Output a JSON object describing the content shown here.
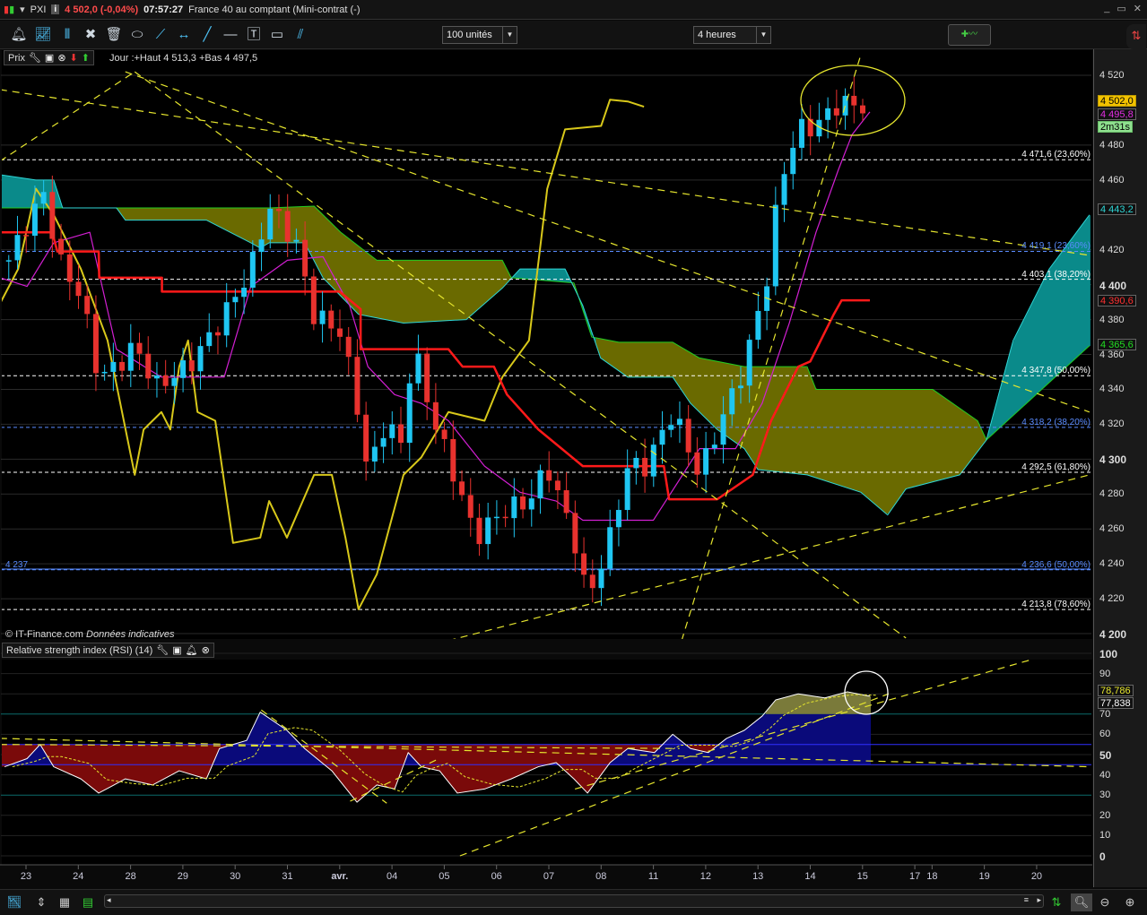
{
  "titlebar": {
    "symbol": "PXI",
    "price_change": "4 502,0 (-0,04%)",
    "time": "07:57:27",
    "instrument": "France 40 au comptant (Mini-contrat  (-)",
    "info_label": "i",
    "window_buttons": [
      "_",
      "▭",
      "✕"
    ]
  },
  "toolbar": {
    "units_dropdown": "100 unités",
    "period_dropdown": "4 heures"
  },
  "price_panel": {
    "header_label": "Prix",
    "day_info": "Jour :+Haut 4 513,3 +Bas 4 497,5",
    "copyright": "© IT-Finance.com",
    "disclaimer": "Données indicatives",
    "left_level_label": "4 237"
  },
  "rsi_panel": {
    "header_label": "Relative strength index (RSI) (14)"
  },
  "price_tags": {
    "last": "4 502,0",
    "tenkan": "4 495,8",
    "countdown": "2m31s",
    "cloud_b": "4 443,2",
    "kijun": "4 390,6",
    "cloud_a": "4 365,6",
    "rsi": "78,786",
    "rsi_signal": "77,838"
  },
  "colors": {
    "up": "#1fc6f2",
    "down": "#e8322e",
    "kijun": "#ff1a1a",
    "tenkan": "#d21fd2",
    "chikou": "#d8c81a",
    "span_a": "#22cc22",
    "span_b": "#2fd6d6",
    "cloud_bull": "#6a6a00",
    "cloud_bear": "#0a8a8a",
    "trend": "#e6e62e",
    "fib_white": "#ffffff",
    "fib_blue": "#5a8cff"
  },
  "chart_data": {
    "type": "candlestick",
    "x_axis": {
      "labels": [
        "23",
        "24",
        "28",
        "29",
        "30",
        "31",
        "avr.",
        "04",
        "05",
        "06",
        "07",
        "08",
        "11",
        "12",
        "13",
        "14",
        "15",
        "17",
        "18",
        "19",
        "20"
      ],
      "positions": [
        0,
        1,
        2,
        3,
        4,
        5,
        6,
        7,
        8,
        9,
        10,
        11,
        12,
        13,
        14,
        15,
        16,
        17,
        17.33,
        18.33,
        19.33
      ]
    },
    "y_axis": {
      "min": 4200,
      "max": 4520,
      "ticks": [
        "4 520",
        "4 480",
        "4 460",
        "4 420",
        "4 400",
        "4 380",
        "4 360",
        "4 340",
        "4 320",
        "4 300",
        "4 280",
        "4 260",
        "4 240",
        "4 220",
        "4 200"
      ],
      "tick_values": [
        4520,
        4480,
        4460,
        4420,
        4400,
        4380,
        4360,
        4340,
        4320,
        4300,
        4280,
        4260,
        4240,
        4220,
        4200
      ],
      "bold": [
        4400,
        4300,
        4200
      ]
    },
    "close_keypoints": [
      [
        -0.33,
        4414
      ],
      [
        0.02,
        4435
      ],
      [
        0.36,
        4453
      ],
      [
        0.62,
        4414
      ],
      [
        1.05,
        4394
      ],
      [
        1.39,
        4347
      ],
      [
        1.73,
        4353
      ],
      [
        2.08,
        4365
      ],
      [
        2.5,
        4342
      ],
      [
        3.1,
        4353
      ],
      [
        3.7,
        4378
      ],
      [
        4.3,
        4409
      ],
      [
        4.65,
        4445
      ],
      [
        5.16,
        4424
      ],
      [
        5.5,
        4383
      ],
      [
        6.02,
        4373
      ],
      [
        6.36,
        4327
      ],
      [
        6.54,
        4291
      ],
      [
        6.88,
        4322
      ],
      [
        7.22,
        4306
      ],
      [
        7.39,
        4368
      ],
      [
        7.74,
        4327
      ],
      [
        8.25,
        4286
      ],
      [
        8.59,
        4255
      ],
      [
        9.11,
        4270
      ],
      [
        9.62,
        4276
      ],
      [
        9.97,
        4296
      ],
      [
        10.48,
        4255
      ],
      [
        10.74,
        4219
      ],
      [
        11.17,
        4255
      ],
      [
        11.51,
        4296
      ],
      [
        11.85,
        4296
      ],
      [
        12.37,
        4327
      ],
      [
        12.88,
        4291
      ],
      [
        13.22,
        4317
      ],
      [
        13.74,
        4353
      ],
      [
        14.17,
        4404
      ],
      [
        14.43,
        4460
      ],
      [
        14.77,
        4489
      ],
      [
        15.11,
        4491
      ],
      [
        15.54,
        4504
      ],
      [
        16.14,
        4502
      ]
    ],
    "kijun": [
      [
        -0.5,
        4430
      ],
      [
        0.5,
        4430
      ],
      [
        0.6,
        4419
      ],
      [
        1.39,
        4419
      ],
      [
        1.4,
        4404
      ],
      [
        2.6,
        4404
      ],
      [
        2.6,
        4396
      ],
      [
        6.0,
        4396
      ],
      [
        6.4,
        4386
      ],
      [
        6.4,
        4363
      ],
      [
        8.08,
        4363
      ],
      [
        8.35,
        4353
      ],
      [
        8.95,
        4353
      ],
      [
        9.2,
        4337
      ],
      [
        9.8,
        4317
      ],
      [
        10.65,
        4296
      ],
      [
        12.2,
        4296
      ],
      [
        12.3,
        4277
      ],
      [
        13.22,
        4277
      ],
      [
        13.9,
        4291
      ],
      [
        14.25,
        4322
      ],
      [
        14.77,
        4353
      ],
      [
        15.0,
        4356
      ],
      [
        15.45,
        4383
      ],
      [
        15.6,
        4391
      ],
      [
        16.14,
        4391
      ]
    ],
    "tenkan": [
      [
        -0.5,
        4404
      ],
      [
        0.02,
        4399
      ],
      [
        0.53,
        4424
      ],
      [
        1.22,
        4430
      ],
      [
        1.73,
        4363
      ],
      [
        2.59,
        4347
      ],
      [
        3.79,
        4347
      ],
      [
        4.3,
        4399
      ],
      [
        5.0,
        4414
      ],
      [
        5.68,
        4416
      ],
      [
        6.19,
        4388
      ],
      [
        6.54,
        4353
      ],
      [
        7.05,
        4337
      ],
      [
        7.56,
        4332
      ],
      [
        8.08,
        4322
      ],
      [
        8.77,
        4296
      ],
      [
        9.45,
        4281
      ],
      [
        10.14,
        4276
      ],
      [
        10.65,
        4265
      ],
      [
        12.0,
        4265
      ],
      [
        12.88,
        4306
      ],
      [
        13.57,
        4306
      ],
      [
        14.08,
        4332
      ],
      [
        14.6,
        4378
      ],
      [
        15.11,
        4430
      ],
      [
        15.54,
        4466
      ],
      [
        15.8,
        4486
      ],
      [
        16.14,
        4499
      ]
    ],
    "chikou": [
      [
        -0.5,
        4389
      ],
      [
        -0.15,
        4409
      ],
      [
        0.19,
        4455
      ],
      [
        0.53,
        4440
      ],
      [
        1.05,
        4409
      ],
      [
        1.56,
        4368
      ],
      [
        2.08,
        4291
      ],
      [
        2.25,
        4317
      ],
      [
        2.59,
        4327
      ],
      [
        2.76,
        4317
      ],
      [
        2.93,
        4353
      ],
      [
        3.1,
        4368
      ],
      [
        3.28,
        4327
      ],
      [
        3.62,
        4322
      ],
      [
        3.96,
        4252
      ],
      [
        4.48,
        4255
      ],
      [
        4.65,
        4276
      ],
      [
        4.99,
        4255
      ],
      [
        5.51,
        4291
      ],
      [
        5.85,
        4291
      ],
      [
        6.11,
        4255
      ],
      [
        6.36,
        4214
      ],
      [
        6.71,
        4234
      ],
      [
        7.22,
        4291
      ],
      [
        7.56,
        4301
      ],
      [
        8.08,
        4327
      ],
      [
        8.77,
        4322
      ],
      [
        9.11,
        4347
      ],
      [
        9.62,
        4368
      ],
      [
        9.97,
        4455
      ],
      [
        10.31,
        4489
      ],
      [
        11.0,
        4491
      ],
      [
        11.17,
        4506
      ],
      [
        11.51,
        4505
      ],
      [
        11.82,
        4502
      ]
    ],
    "span_a": [
      [
        -0.5,
        4444
      ],
      [
        4.65,
        4444
      ],
      [
        5.51,
        4445
      ],
      [
        6.02,
        4430
      ],
      [
        6.71,
        4414
      ],
      [
        9.11,
        4414
      ],
      [
        9.28,
        4404
      ],
      [
        10.48,
        4401
      ],
      [
        10.82,
        4370
      ],
      [
        11.34,
        4367
      ],
      [
        12.37,
        4367
      ],
      [
        12.88,
        4358
      ],
      [
        13.74,
        4353
      ],
      [
        14.94,
        4353
      ],
      [
        15.11,
        4340
      ],
      [
        17.34,
        4340
      ],
      [
        18.2,
        4322
      ],
      [
        18.37,
        4311
      ],
      [
        20.34,
        4365
      ]
    ],
    "span_b": [
      [
        -0.5,
        4463
      ],
      [
        0.19,
        4460
      ],
      [
        0.53,
        4460
      ],
      [
        0.7,
        4444
      ],
      [
        1.73,
        4444
      ],
      [
        1.9,
        4437
      ],
      [
        3.45,
        4437
      ],
      [
        4.3,
        4424
      ],
      [
        4.48,
        4421
      ],
      [
        4.65,
        4424
      ],
      [
        5.33,
        4424
      ],
      [
        5.68,
        4404
      ],
      [
        6.36,
        4383
      ],
      [
        7.22,
        4378
      ],
      [
        8.42,
        4380
      ],
      [
        9.11,
        4398
      ],
      [
        9.45,
        4409
      ],
      [
        10.31,
        4409
      ],
      [
        10.65,
        4388
      ],
      [
        10.99,
        4358
      ],
      [
        11.51,
        4347
      ],
      [
        12.37,
        4347
      ],
      [
        12.71,
        4332
      ],
      [
        13.22,
        4317
      ],
      [
        13.74,
        4306
      ],
      [
        14.0,
        4294
      ],
      [
        14.94,
        4291
      ],
      [
        15.97,
        4281
      ],
      [
        16.48,
        4268
      ],
      [
        16.83,
        4283
      ],
      [
        17.86,
        4291
      ],
      [
        18.37,
        4311
      ],
      [
        18.88,
        4368
      ],
      [
        19.57,
        4409
      ],
      [
        20.34,
        4440
      ]
    ],
    "fib_levels": [
      {
        "label": "4 471,6 (23,60%)",
        "value": 4471.6,
        "color": "white"
      },
      {
        "label": "4 419,1 (23,60%)",
        "value": 4419.1,
        "color": "blue"
      },
      {
        "label": "4 403,1 (38,20%)",
        "value": 4403.1,
        "color": "white"
      },
      {
        "label": "4 347,8 (50,00%)",
        "value": 4347.8,
        "color": "white"
      },
      {
        "label": "4 318,2 (38,20%)",
        "value": 4318.2,
        "color": "blue"
      },
      {
        "label": "4 292,5 (61,80%)",
        "value": 4292.5,
        "color": "white"
      },
      {
        "label": "4 236,6 (50,00%)",
        "value": 4236.6,
        "color": "blue"
      },
      {
        "label": "4 213,8 (78,60%)",
        "value": 4213.8,
        "color": "white"
      }
    ],
    "trendlines": [
      [
        [
          -0.5,
          4511.8
        ],
        [
          20.34,
          4416.8
        ]
      ],
      [
        [
          1.9,
          4522
        ],
        [
          20.34,
          4327
        ]
      ],
      [
        [
          -0.5,
          4470.7
        ],
        [
          2.08,
          4522
        ]
      ],
      [
        [
          2.08,
          4522
        ],
        [
          16.83,
          4197.5
        ]
      ],
      [
        [
          8.08,
          4196
        ],
        [
          20.34,
          4291
        ]
      ],
      [
        [
          12.54,
          4196
        ],
        [
          15.97,
          4532
        ]
      ]
    ],
    "rsi": {
      "y_ticks": [
        100,
        90,
        80,
        70,
        60,
        50,
        40,
        30,
        20,
        10,
        0
      ],
      "values": [
        [
          -0.41,
          44
        ],
        [
          0.02,
          48
        ],
        [
          0.27,
          55
        ],
        [
          0.53,
          44
        ],
        [
          1.05,
          38
        ],
        [
          1.39,
          31
        ],
        [
          1.9,
          38
        ],
        [
          2.42,
          35
        ],
        [
          2.93,
          42
        ],
        [
          3.45,
          38
        ],
        [
          3.7,
          53
        ],
        [
          4.22,
          57
        ],
        [
          4.48,
          71
        ],
        [
          4.99,
          62
        ],
        [
          5.33,
          53
        ],
        [
          5.85,
          42
        ],
        [
          6.33,
          26.5
        ],
        [
          6.71,
          35
        ],
        [
          7.05,
          33
        ],
        [
          7.31,
          51
        ],
        [
          7.56,
          44
        ],
        [
          7.91,
          42
        ],
        [
          8.25,
          31
        ],
        [
          8.77,
          33
        ],
        [
          9.28,
          38
        ],
        [
          9.8,
          44
        ],
        [
          10.14,
          46
        ],
        [
          10.48,
          38
        ],
        [
          10.74,
          31
        ],
        [
          11.17,
          46
        ],
        [
          11.51,
          53
        ],
        [
          12.02,
          51
        ],
        [
          12.37,
          60
        ],
        [
          12.71,
          53
        ],
        [
          13.05,
          51
        ],
        [
          13.4,
          58
        ],
        [
          13.74,
          62
        ],
        [
          14.08,
          69
        ],
        [
          14.34,
          77
        ],
        [
          14.77,
          80
        ],
        [
          15.28,
          78
        ],
        [
          15.71,
          81
        ],
        [
          16.14,
          78.8
        ]
      ],
      "trendlines": [
        [
          [
            -0.5,
            58
          ],
          [
            20.34,
            44
          ]
        ],
        [
          [
            -0.5,
            55
          ],
          [
            12.5,
            53
          ]
        ],
        [
          [
            10.5,
            33
          ],
          [
            20.34,
            105
          ]
        ],
        [
          [
            8.3,
            0
          ],
          [
            16.5,
            80
          ]
        ],
        [
          [
            4.5,
            72
          ],
          [
            6.9,
            26
          ]
        ],
        [
          [
            6.2,
            27
          ],
          [
            7.9,
            48
          ]
        ]
      ]
    }
  }
}
